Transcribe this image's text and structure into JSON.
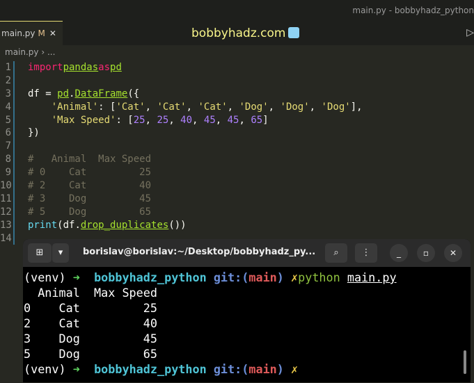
{
  "window_title": "main.py - bobbyhadz_python",
  "tab": {
    "label": "main.py",
    "modified": "M",
    "close": "✕"
  },
  "brand": "bobbyhadz.com",
  "breadcrumb": "main.py › ...",
  "code_lines": [
    {
      "n": "1"
    },
    {
      "n": "2"
    },
    {
      "n": "3"
    },
    {
      "n": "4"
    },
    {
      "n": "5"
    },
    {
      "n": "6"
    },
    {
      "n": "7"
    },
    {
      "n": "8"
    },
    {
      "n": "9"
    },
    {
      "n": "10"
    },
    {
      "n": "11"
    },
    {
      "n": "12"
    },
    {
      "n": "13"
    },
    {
      "n": "14"
    }
  ],
  "code": {
    "l1": [
      "import",
      "pandas",
      "as",
      "pd"
    ],
    "l3": [
      "df = ",
      "pd",
      ".",
      "DataFrame",
      "({"
    ],
    "l4": [
      "    ",
      "'Animal'",
      ": [",
      "'Cat'",
      ", ",
      "'Cat'",
      ", ",
      "'Cat'",
      ", ",
      "'Dog'",
      ", ",
      "'Dog'",
      ", ",
      "'Dog'",
      "],"
    ],
    "l5": [
      "    ",
      "'Max Speed'",
      ": [",
      "25",
      ", ",
      "25",
      ", ",
      "40",
      ", ",
      "45",
      ", ",
      "45",
      ", ",
      "65",
      "]"
    ],
    "l6": "})",
    "l8": "#   Animal  Max Speed",
    "l9": "# 0    Cat         25",
    "l10": "# 2    Cat         40",
    "l11": "# 3    Dog         45",
    "l12": "# 5    Dog         65",
    "l13": [
      "print",
      "(df.",
      "drop_duplicates",
      "())"
    ]
  },
  "terminal": {
    "title": "borislav@borislav:~/Desktop/bobbyhadz_py...",
    "prompt": {
      "venv": "(venv)",
      "arrow": "➜",
      "dir": "bobbyhadz_python",
      "git": "git:(",
      "branch": "main",
      "git_close": ")",
      "dirty": "✗"
    },
    "command": [
      "python",
      "main.py"
    ],
    "output": [
      "  Animal  Max Speed",
      "0    Cat         25",
      "2    Cat         40",
      "3    Dog         45",
      "5    Dog         65"
    ]
  }
}
